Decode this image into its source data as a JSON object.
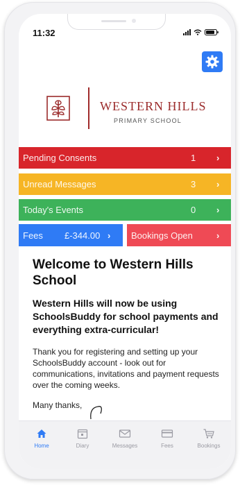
{
  "status_bar": {
    "time": "11:32"
  },
  "header": {
    "settings_icon": "gear-icon"
  },
  "school": {
    "name": "WESTERN HILLS",
    "subtitle": "PRIMARY SCHOOL",
    "logo_icon": "tree-crest-icon",
    "brand_color": "#9b2b2b"
  },
  "summary_rows": [
    {
      "label": "Pending Consents",
      "count": "1",
      "color": "#d8252b"
    },
    {
      "label": "Unread Messages",
      "count": "3",
      "color": "#f6b525"
    },
    {
      "label": "Today's Events",
      "count": "0",
      "color": "#3db25a"
    }
  ],
  "fees_button": {
    "label": "Fees",
    "amount": "£-344.00",
    "color": "#2f7bf5"
  },
  "bookings_button": {
    "label": "Bookings Open",
    "color": "#ef4a55"
  },
  "welcome": {
    "title": "Welcome to Western Hills School",
    "subtitle": "Western Hills will now be using SchoolsBuddy for school payments and everything extra-curricular!",
    "body": "Thank you for registering and setting up your SchoolsBuddy account - look out for communications, invitations and payment requests over the coming weeks.",
    "signoff": "Many thanks,"
  },
  "tabs": [
    {
      "label": "Home",
      "icon": "home-icon",
      "active": true
    },
    {
      "label": "Diary",
      "icon": "calendar-icon",
      "active": false
    },
    {
      "label": "Messages",
      "icon": "envelope-icon",
      "active": false
    },
    {
      "label": "Fees",
      "icon": "credit-card-icon",
      "active": false
    },
    {
      "label": "Bookings",
      "icon": "cart-icon",
      "active": false
    }
  ],
  "accent_color": "#2f7bf5"
}
